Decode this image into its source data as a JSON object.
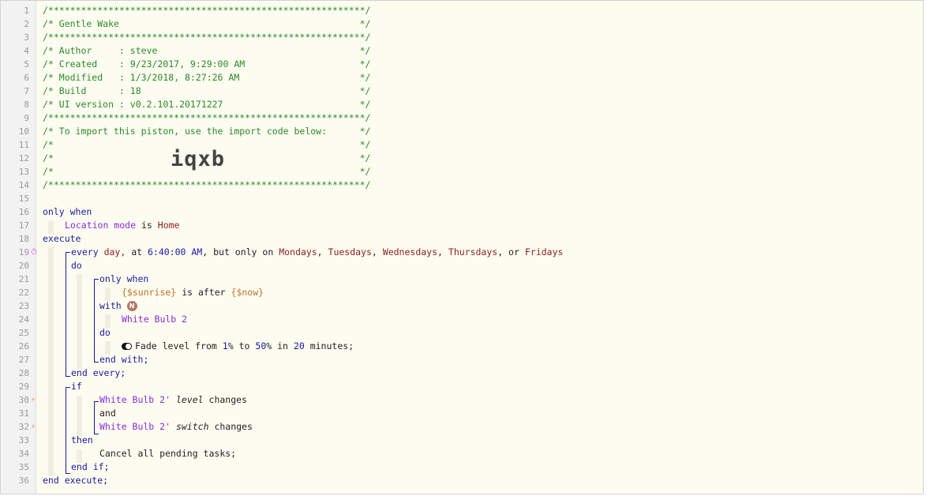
{
  "header_comments": [
    "/**********************************************************/",
    "/* Gentle Wake                                            */",
    "/**********************************************************/",
    "/* Author     : steve                                     */",
    "/* Created    : 9/23/2017, 9:29:00 AM                     */",
    "/* Modified   : 1/3/2018, 8:27:26 AM                      */",
    "/* Build      : 18                                        */",
    "/* UI version : v0.2.101.20171227                         */",
    "/**********************************************************/",
    "/* To import this piston, use the import code below:      */",
    "/*                                                        */",
    "/*                                                        */",
    "/*                                                        */",
    "/**********************************************************/"
  ],
  "import_code": "iqxb",
  "line_numbers": [
    "1",
    "2",
    "3",
    "4",
    "5",
    "6",
    "7",
    "8",
    "9",
    "10",
    "11",
    "12",
    "13",
    "14",
    "15",
    "16",
    "17",
    "18",
    "19",
    "20",
    "21",
    "22",
    "23",
    "24",
    "25",
    "26",
    "27",
    "28",
    "29",
    "30",
    "31",
    "32",
    "33",
    "34",
    "35",
    "36"
  ],
  "code": {
    "l16_only_when": "only when",
    "l17_location": "Location",
    "l17_mode": "mode",
    "l17_is": "is",
    "l17_home": "Home",
    "l18_execute": "execute",
    "l19_every": "every",
    "l19_day": "day,",
    "l19_at": "at",
    "l19_time": "6:40:00 AM",
    "l19_but": ", but only on",
    "l19_mon": "Mondays",
    "l19_tue": "Tuesdays",
    "l19_wed": "Wednesdays",
    "l19_thu": "Thursdays",
    "l19_or": ", or",
    "l19_fri": "Fridays",
    "l20_do": "do",
    "l21_only_when": "only when",
    "l22_sunrise": "{$sunrise}",
    "l22_is_after": "is after",
    "l22_now": "{$now}",
    "l23_with": "with",
    "l23_badge": "N",
    "l24_device": "White Bulb 2",
    "l25_do": "do",
    "l26_fade": "Fade level from",
    "l26_from": "1",
    "l26_to": "to",
    "l26_to_val": "50",
    "l26_in": "in",
    "l26_mins": "20",
    "l26_minutes": "minutes;",
    "l27_end_with": "end with;",
    "l28_end_every": "end every;",
    "l29_if": "if",
    "l30_device": "White Bulb 2'",
    "l30_attr": "level",
    "l30_changes": "changes",
    "l31_and": "and",
    "l32_device": "White Bulb 2'",
    "l32_attr": "switch",
    "l32_changes": "changes",
    "l33_then": "then",
    "l34_cancel": "Cancel all pending tasks;",
    "l35_end_if": "end if;",
    "l36_end_execute": "end execute;"
  },
  "colors": {
    "comment": "#2a8a2a",
    "keyword": "#1a1aa6",
    "device": "#8a2be2",
    "value": "#8b1e1e",
    "expression": "#c0722a",
    "background": "#fdfcf0"
  },
  "icons": [
    "clock-icon",
    "bolt-icon",
    "toggle-icon"
  ]
}
